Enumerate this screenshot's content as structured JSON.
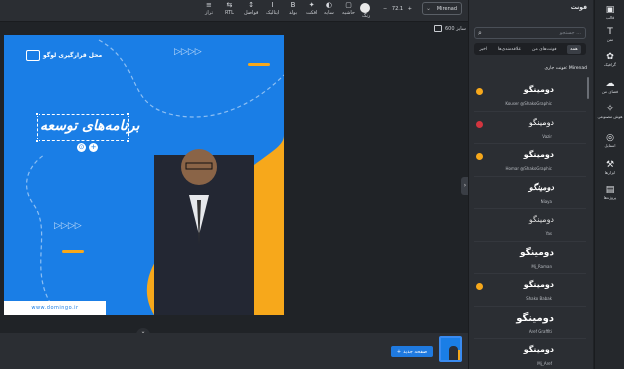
{
  "toolbar": {
    "font_name": "Mirenad",
    "font_size": "72.1",
    "size_minus": "−",
    "size_plus": "+",
    "items": [
      {
        "label": "رنگ",
        "icon": "●"
      },
      {
        "label": "حاشیه",
        "icon": "▢"
      },
      {
        "label": "سایه",
        "icon": "◐"
      },
      {
        "label": "افکت",
        "icon": "✦"
      },
      {
        "label": "بولد",
        "icon": "B"
      },
      {
        "label": "ایتالیک",
        "icon": "I"
      },
      {
        "label": "فواصل",
        "icon": "↕"
      },
      {
        "label": "RTL",
        "icon": "⇆"
      },
      {
        "label": "تراز",
        "icon": "≡"
      }
    ]
  },
  "canvas": {
    "size_label": "سایز 600",
    "logo_text": "محل قرارگیری لوگو",
    "arrows": "▷▷▷▷",
    "title_text": "برنامه‌های توسعه",
    "tool_icons": [
      "⊙",
      "+"
    ],
    "url": "www.domingo.ir",
    "accent_color": "#f7a81b",
    "bg_color": "#1a7ee6"
  },
  "bottom": {
    "new_page_label": "صفحه جدید",
    "new_page_icon": "+",
    "collapse_icon": "⌄"
  },
  "font_panel": {
    "title": "فونت",
    "search_placeholder": "جستجو ...",
    "tabs": [
      "همه",
      "فونت‌های من",
      "علاقه‌مندی‌ها",
      "اخیر"
    ],
    "current_font": "فونت جاری: Mirenad",
    "fonts": [
      {
        "sample": "دومینگو",
        "name": "Kouser @ShakoGraphic",
        "badge": "#f7a81b"
      },
      {
        "sample": "دومینگو",
        "name": "Vazir",
        "badge": "#d2353f"
      },
      {
        "sample": "دومینگو",
        "name": "Homar @ShakoGraphic",
        "badge": "#f7a81b"
      },
      {
        "sample": "دومینگو",
        "name": "Niaya",
        "badge": ""
      },
      {
        "sample": "دومینگو",
        "name": "Yas",
        "badge": ""
      },
      {
        "sample": "دومینگو",
        "name": "Mj_Raman",
        "badge": ""
      },
      {
        "sample": "دومینگو",
        "name": "Shako Babak",
        "badge": "#f7a81b"
      },
      {
        "sample": "دومینگو",
        "name": "Aref Graffiti",
        "badge": ""
      },
      {
        "sample": "دومینگو",
        "name": "Mj_Aref",
        "badge": ""
      }
    ]
  },
  "sidebar": {
    "items": [
      {
        "label": "قالب",
        "icon": "▣"
      },
      {
        "label": "متن",
        "icon": "T"
      },
      {
        "label": "گرافیک",
        "icon": "✿"
      },
      {
        "label": "فضای من",
        "icon": "☁"
      },
      {
        "label": "هوش مصنوعی",
        "icon": "✧"
      },
      {
        "label": "استایل",
        "icon": "◎"
      },
      {
        "label": "ابزارها",
        "icon": "⚒"
      },
      {
        "label": "پروژه‌ها",
        "icon": "▤"
      }
    ]
  }
}
